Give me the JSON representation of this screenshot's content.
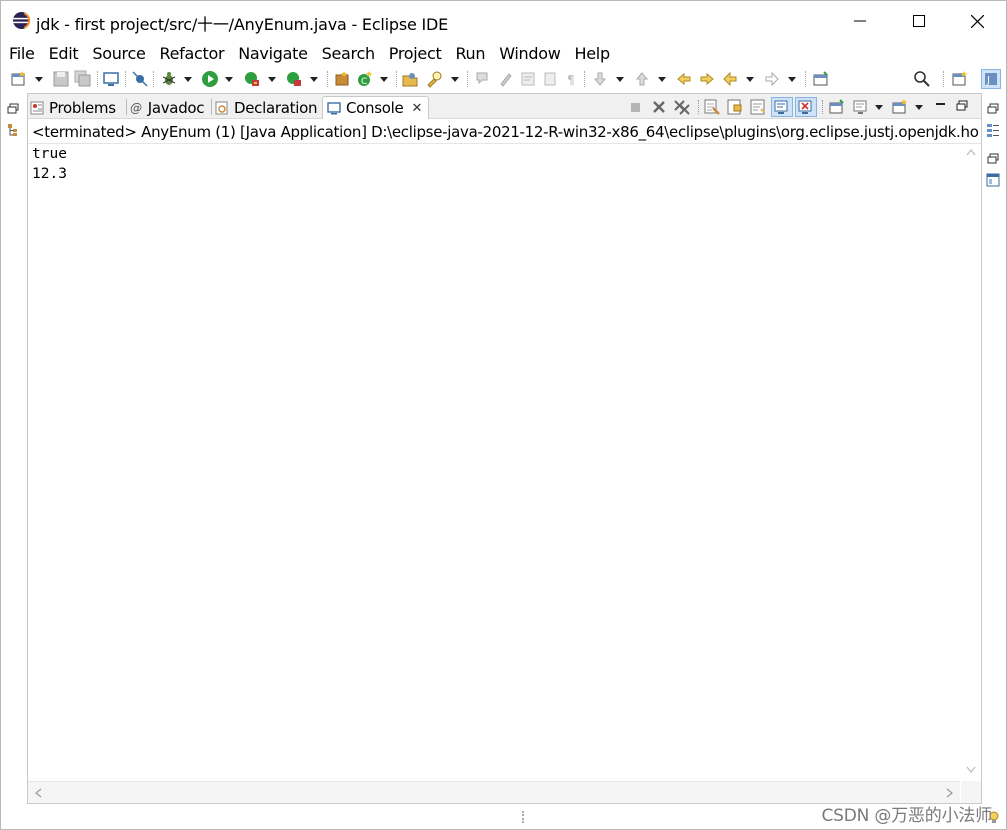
{
  "window": {
    "title": "jdk - first project/src/十一/AnyEnum.java - Eclipse IDE",
    "icon": "eclipse-logo-icon"
  },
  "menu": [
    "File",
    "Edit",
    "Source",
    "Refactor",
    "Navigate",
    "Search",
    "Project",
    "Run",
    "Window",
    "Help"
  ],
  "tabs": [
    {
      "label": "Problems",
      "icon": "problems-icon",
      "active": false
    },
    {
      "label": "Javadoc",
      "icon": "javadoc-icon",
      "active": false
    },
    {
      "label": "Declaration",
      "icon": "declaration-icon",
      "active": false
    },
    {
      "label": "Console",
      "icon": "console-icon",
      "active": true
    }
  ],
  "console": {
    "status": "<terminated> AnyEnum (1) [Java Application] D:\\eclipse-java-2021-12-R-win32-x86_64\\eclipse\\plugins\\org.eclipse.justj.openjdk.ho",
    "lines": [
      "true",
      "12.3"
    ]
  },
  "watermark": "CSDN @万恶的小法师",
  "colors": {
    "accent": "#3a6ea5",
    "run_green": "#2e9e3e",
    "stop_red": "#d0312d"
  }
}
